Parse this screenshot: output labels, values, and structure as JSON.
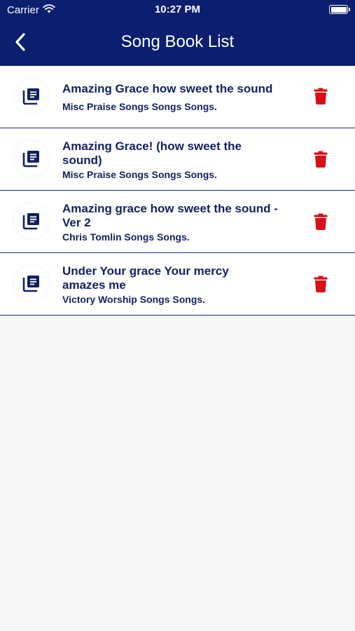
{
  "status_bar": {
    "carrier": "Carrier",
    "time": "10:27 PM"
  },
  "header": {
    "title": "Song Book List",
    "back_icon": "chevron-left-icon"
  },
  "colors": {
    "header_bg": "#0b1f6e",
    "text": "#13215f",
    "delete": "#d90f16"
  },
  "songs": [
    {
      "title": "Amazing Grace how sweet the sound",
      "subtitle": "Misc Praise Songs Songs Songs."
    },
    {
      "title": "Amazing Grace! (how sweet the sound)",
      "subtitle": "Misc Praise Songs Songs Songs."
    },
    {
      "title": "Amazing grace how sweet the sound - Ver 2",
      "subtitle": "Chris Tomlin Songs Songs."
    },
    {
      "title": "Under Your grace Your mercy amazes me",
      "subtitle": "Victory Worship Songs Songs."
    }
  ]
}
